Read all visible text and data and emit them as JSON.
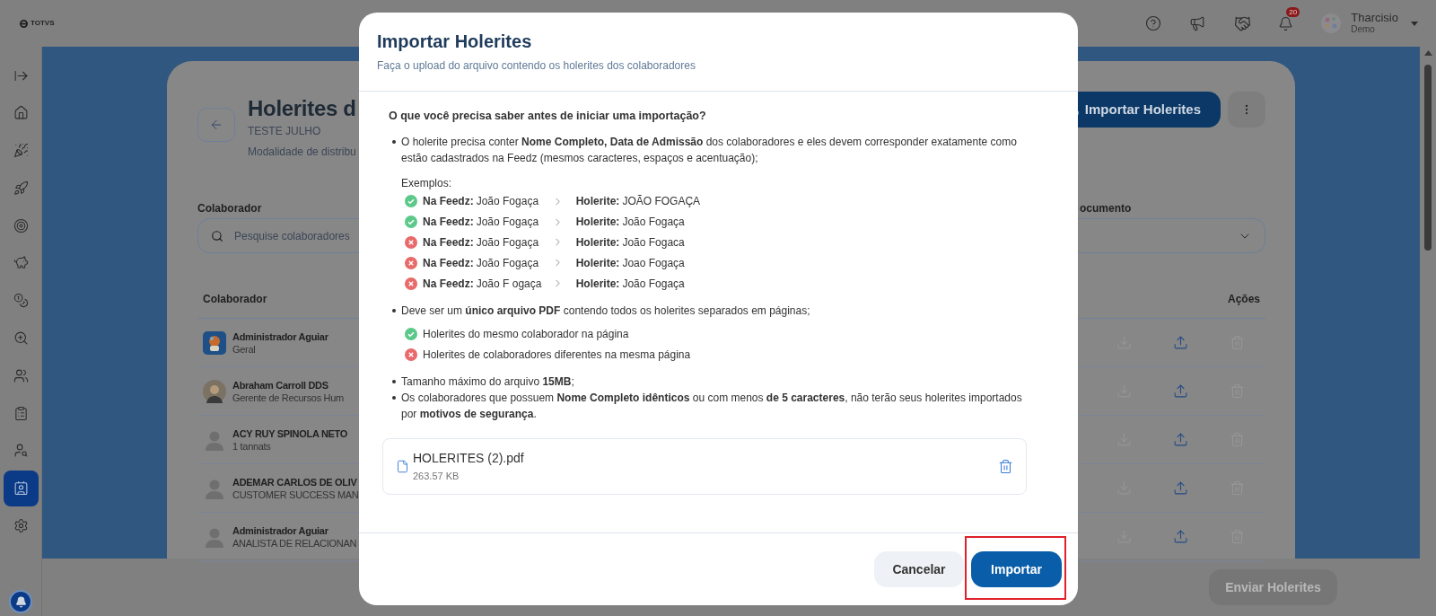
{
  "header": {
    "logo": "TOTVS",
    "notifications": "20",
    "user_name": "Tharcisio",
    "user_role": "Demo"
  },
  "sidebar": {
    "items": [
      {
        "selected": false
      },
      {
        "selected": false
      },
      {
        "selected": false
      },
      {
        "selected": false
      },
      {
        "selected": false
      },
      {
        "selected": false
      },
      {
        "selected": false
      },
      {
        "selected": false
      },
      {
        "selected": false
      },
      {
        "selected": false
      },
      {
        "selected": false
      },
      {
        "selected": true
      },
      {
        "selected": false
      }
    ]
  },
  "page": {
    "title": "Holerites d",
    "subtitle": "TESTE JULHO",
    "mode": "Modalidade de distribu",
    "import_button": "Importar Holerites",
    "search_label": "Colaborador",
    "search_placeholder": "Pesquise colaboradores",
    "document_label": "ocumento",
    "columns": [
      "Colaborador",
      "Ações"
    ],
    "rows": [
      {
        "name": "Administrador Aguiar",
        "role": "Geral",
        "kind": "picture",
        "download_disabled": true,
        "delete_disabled": true
      },
      {
        "name": "Abraham Carroll DDS",
        "role": "Gerente de Recursos Hum",
        "download_disabled": true,
        "delete_disabled": true
      },
      {
        "name": "ACY RUY SPINOLA NETO",
        "role": "1 tannats",
        "kind": "placeholder",
        "download_disabled": true,
        "delete_disabled": true
      },
      {
        "name": "ADEMAR CARLOS DE OLIV",
        "role": "CUSTOMER SUCCESS MAN",
        "kind": "placeholder",
        "download_disabled": true,
        "delete_disabled": true
      },
      {
        "name": "Administrador Aguiar",
        "role": "ANALISTA DE RELACIONAN",
        "kind": "placeholder",
        "download_disabled": true,
        "delete_disabled": true
      }
    ],
    "send_button": {
      "label": "Enviar Holerites",
      "disabled": true
    }
  },
  "modal": {
    "title": "Importar Holerites",
    "subtitle": "Faça o upload do arquivo contendo os holerites dos colaboradores",
    "question": "O que você precisa saber antes de iniciar uma importação?",
    "requirements": [
      {
        "text": "O holerite precisa conter **Nome Completo, Data de Admissão** dos colaboradores e eles devem corresponder exatamente como estão cadastrados na Feedz (mesmos caracteres, espaços e acentuação);",
        "examples_label": "Exemplos:",
        "examples": [
          {
            "ok": true,
            "feedz_label": "Na Feedz:",
            "feedz": "João Fogaça",
            "holerite_label": "Holerite:",
            "holerite": "JOÃO FOGAÇA"
          },
          {
            "ok": true,
            "feedz_label": "Na Feedz:",
            "feedz": "João Fogaça",
            "holerite_label": "Holerite:",
            "holerite": "João Fogaça"
          },
          {
            "ok": false,
            "feedz_label": "Na Feedz:",
            "feedz": "João Fogaça",
            "holerite_label": "Holerite:",
            "holerite": "João Fogaca"
          },
          {
            "ok": false,
            "feedz_label": "Na Feedz:",
            "feedz": "João Fogaça",
            "holerite_label": "Holerite:",
            "holerite": "Joao Fogaça"
          },
          {
            "ok": false,
            "feedz_label": "Na Feedz:",
            "feedz": "João F ogaça",
            "holerite_label": "Holerite:",
            "holerite": "João Fogaça"
          }
        ]
      },
      {
        "text": "Deve ser um **único arquivo PDF** contendo todos os holerites separados em páginas;",
        "checks": [
          {
            "ok": true,
            "text": "Holerites do mesmo colaborador na página"
          },
          {
            "ok": false,
            "text": "Holerites de colaboradores diferentes na mesma página"
          }
        ]
      },
      {
        "text": "Tamanho máximo do arquivo **15MB**;"
      },
      {
        "text": "Os colaboradores que possuem **Nome Completo idênticos** ou com menos **de 5 caracteres**, não terão seus holerites importados por **motivos de segurança**."
      }
    ],
    "file": {
      "name": "HOLERITES (2).pdf",
      "size": "263.57 KB"
    },
    "cancel_button": "Cancelar",
    "import_button": "Importar"
  }
}
